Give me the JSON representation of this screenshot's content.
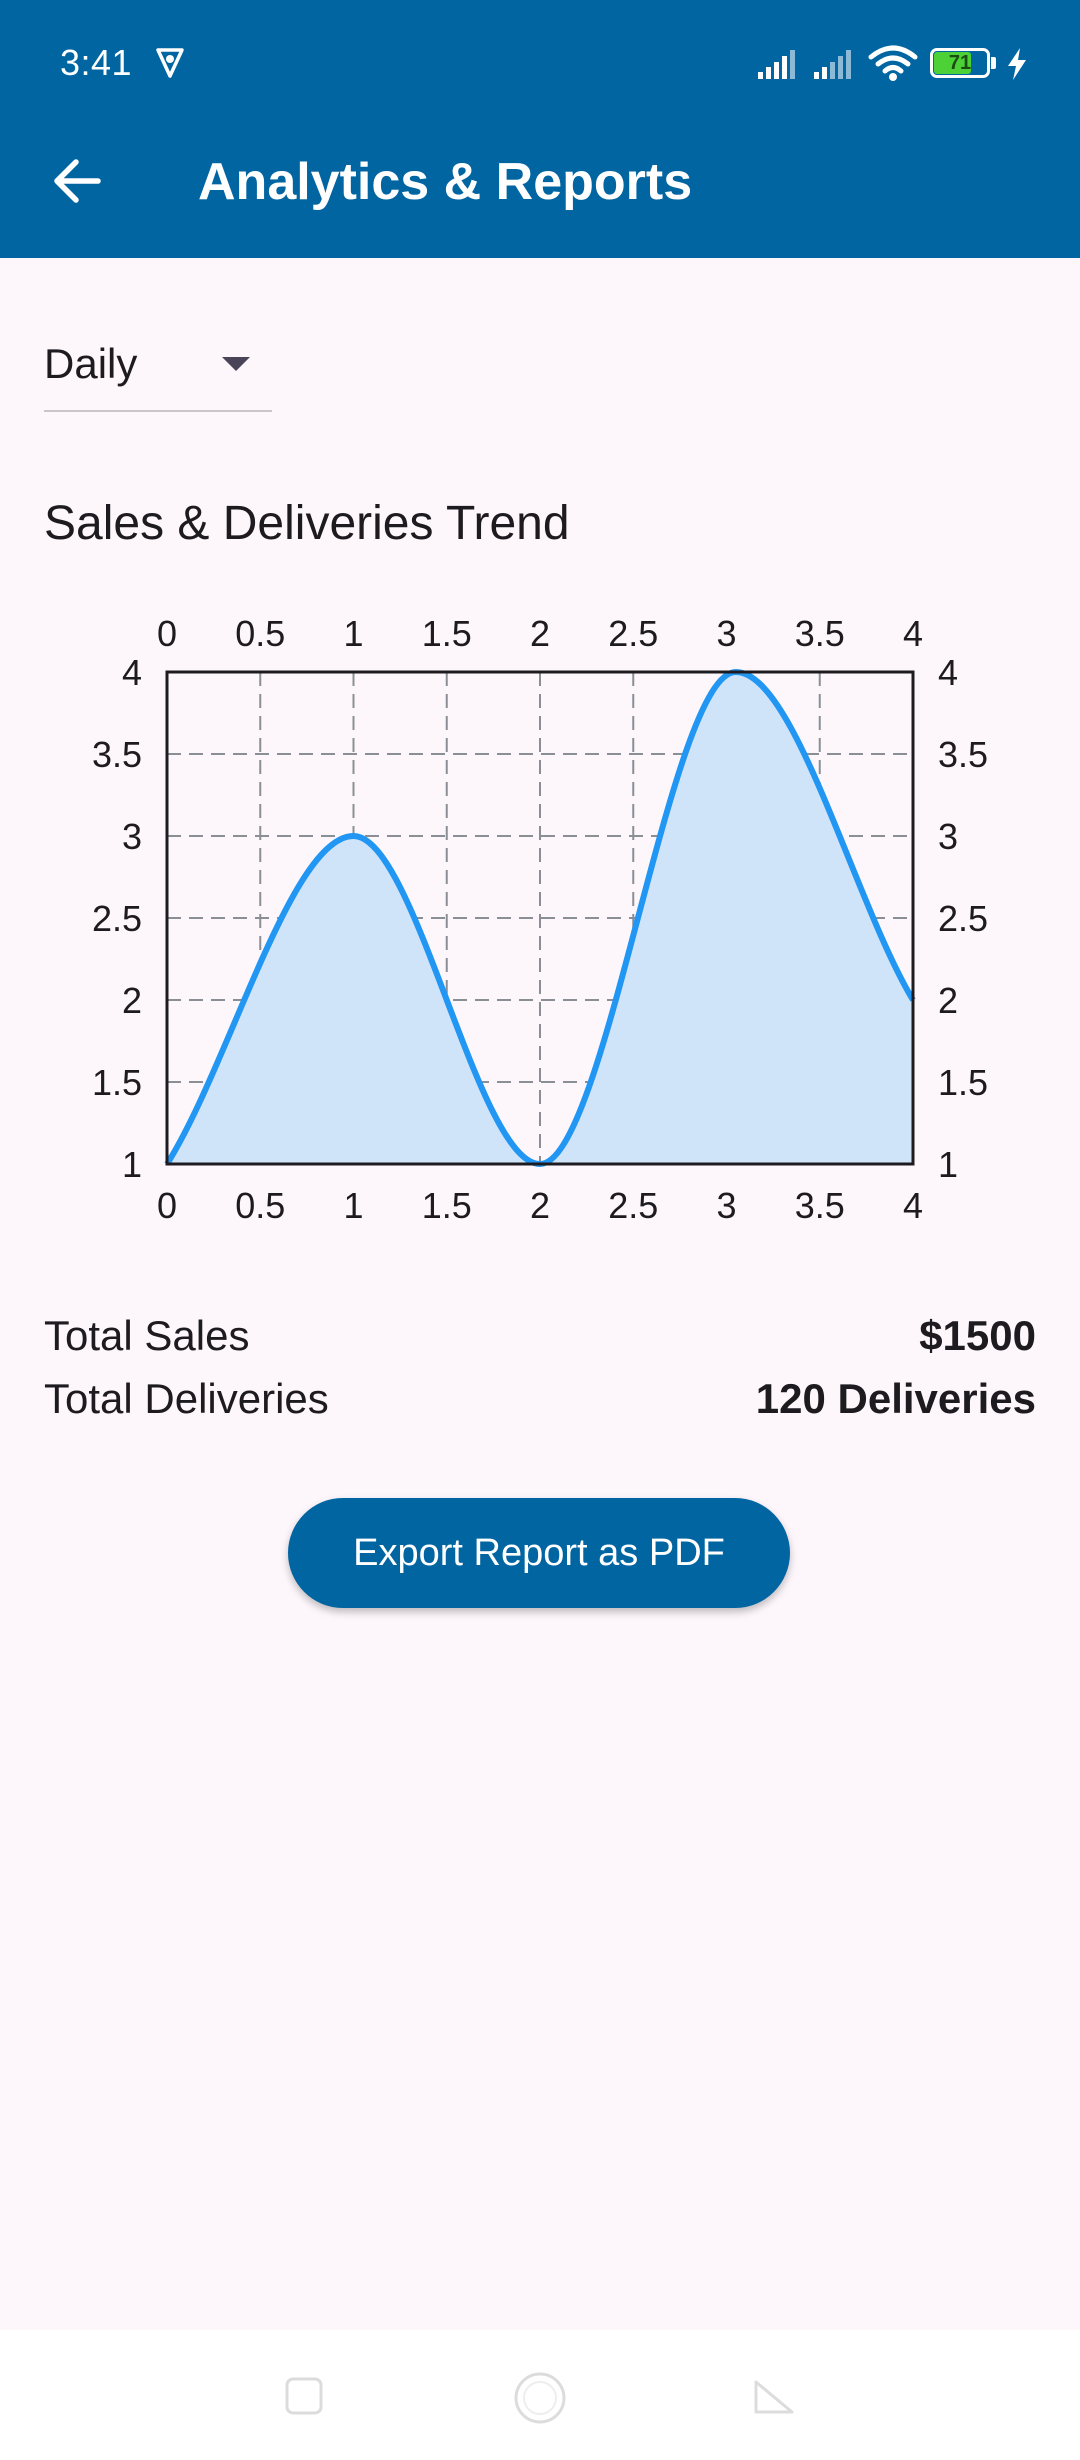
{
  "status_bar": {
    "time": "3:41",
    "battery": "71",
    "icons": [
      "vpn-icon",
      "signal-icon",
      "signal-icon",
      "wifi-icon",
      "battery-icon",
      "charging-icon"
    ]
  },
  "app_bar": {
    "title": "Analytics & Reports",
    "back_icon": "arrow-back-icon",
    "color": "#0165a2"
  },
  "period_dropdown": {
    "selected": "Daily",
    "icon": "dropdown-arrow-icon"
  },
  "chart_section": {
    "title": "Sales & Deliveries Trend"
  },
  "chart_data": {
    "type": "area",
    "x": [
      0,
      1,
      2,
      3.05,
      4
    ],
    "y": [
      1,
      3,
      1,
      4,
      2
    ],
    "curved": true,
    "xlim": [
      0,
      4
    ],
    "ylim": [
      1,
      4
    ],
    "x_ticks": [
      "0",
      "0.5",
      "1",
      "1.5",
      "2",
      "2.5",
      "3",
      "3.5",
      "4"
    ],
    "y_ticks": [
      "1",
      "1.5",
      "2",
      "2.5",
      "3",
      "3.5",
      "4"
    ],
    "x_axes": "top and bottom",
    "y_axes": "left and right",
    "grid": true,
    "grid_style": "dashed",
    "line_color": "#2196f3",
    "fill_color": "#d0e4f9"
  },
  "summary": {
    "total_sales_label": "Total Sales",
    "total_sales_value": "$1500",
    "total_deliveries_label": "Total Deliveries",
    "total_deliveries_value": "120 Deliveries"
  },
  "export_button": {
    "label": "Export Report as PDF"
  },
  "nav_bar": {
    "icons": [
      "recent-apps-icon",
      "home-icon",
      "back-icon"
    ]
  }
}
